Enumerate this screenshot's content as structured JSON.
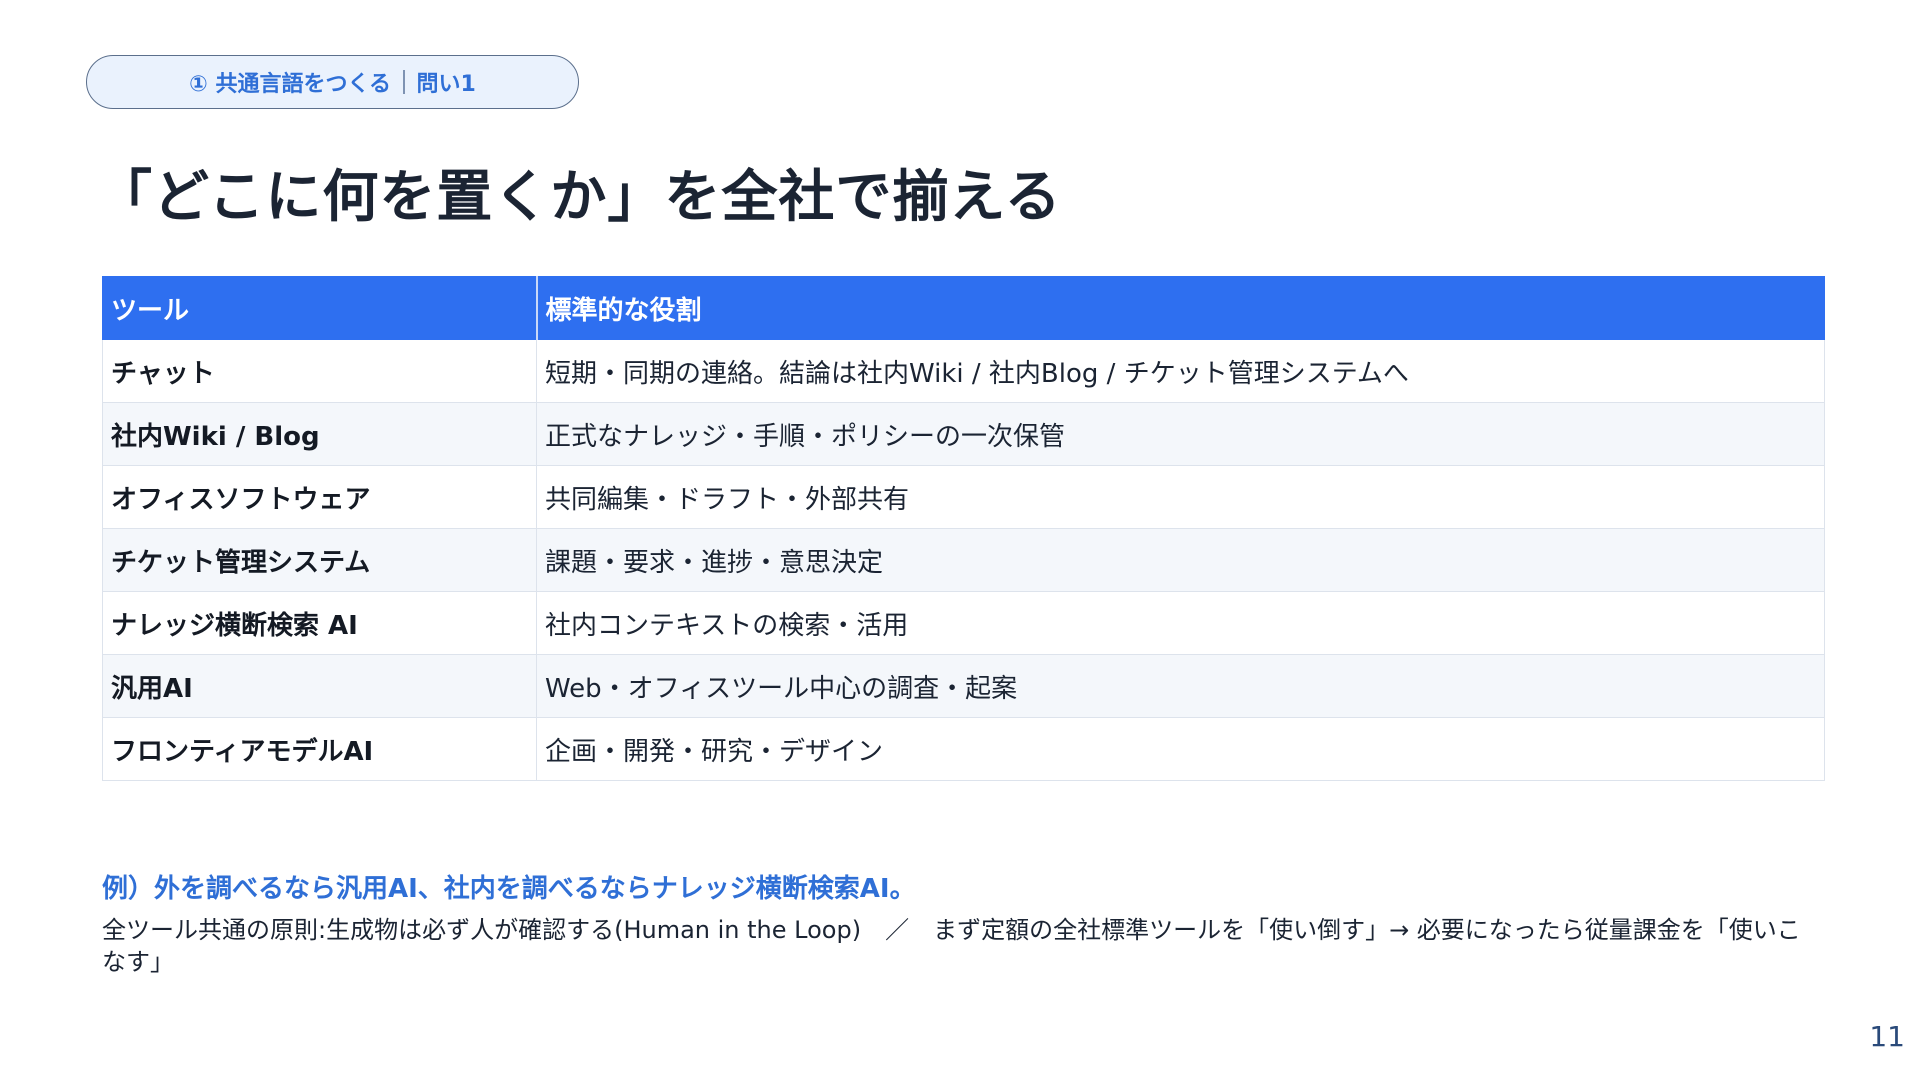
{
  "header": {
    "tag_section": "① 共通言語をつくる",
    "tag_question": "問い1",
    "title": "「どこに何を置くか」を全社で揃える"
  },
  "table": {
    "columns": [
      "ツール",
      "標準的な役割"
    ],
    "rows": [
      {
        "tool": "チャット",
        "role": "短期・同期の連絡。結論は社内Wiki / 社内Blog / チケット管理システムへ"
      },
      {
        "tool": "社内Wiki / Blog",
        "role": "正式なナレッジ・手順・ポリシーの一次保管"
      },
      {
        "tool": "オフィスソフトウェア",
        "role": "共同編集・ドラフト・外部共有"
      },
      {
        "tool": "チケット管理システム",
        "role": "課題・要求・進捗・意思決定"
      },
      {
        "tool": "ナレッジ横断検索 AI",
        "role": "社内コンテキストの検索・活用"
      },
      {
        "tool": "汎用AI",
        "role": "Web・オフィスツール中心の調査・起案"
      },
      {
        "tool": "フロンティアモデルAI",
        "role": "企画・開発・研究・デザイン"
      }
    ]
  },
  "footer": {
    "example": "例）外を調べるなら汎用AI、社内を調べるならナレッジ横断検索AI。",
    "note": "全ツール共通の原則:生成物は必ず人が確認する(Human in the Loop)　／　まず定額の全社標準ツールを「使い倒す」→ 必要になったら従量課金を「使いこなす」"
  },
  "page_number": "11",
  "colors": {
    "accent": "#2e6ff0",
    "accent_text": "#2f6fd6",
    "pill_bg": "#eaf2fd"
  }
}
